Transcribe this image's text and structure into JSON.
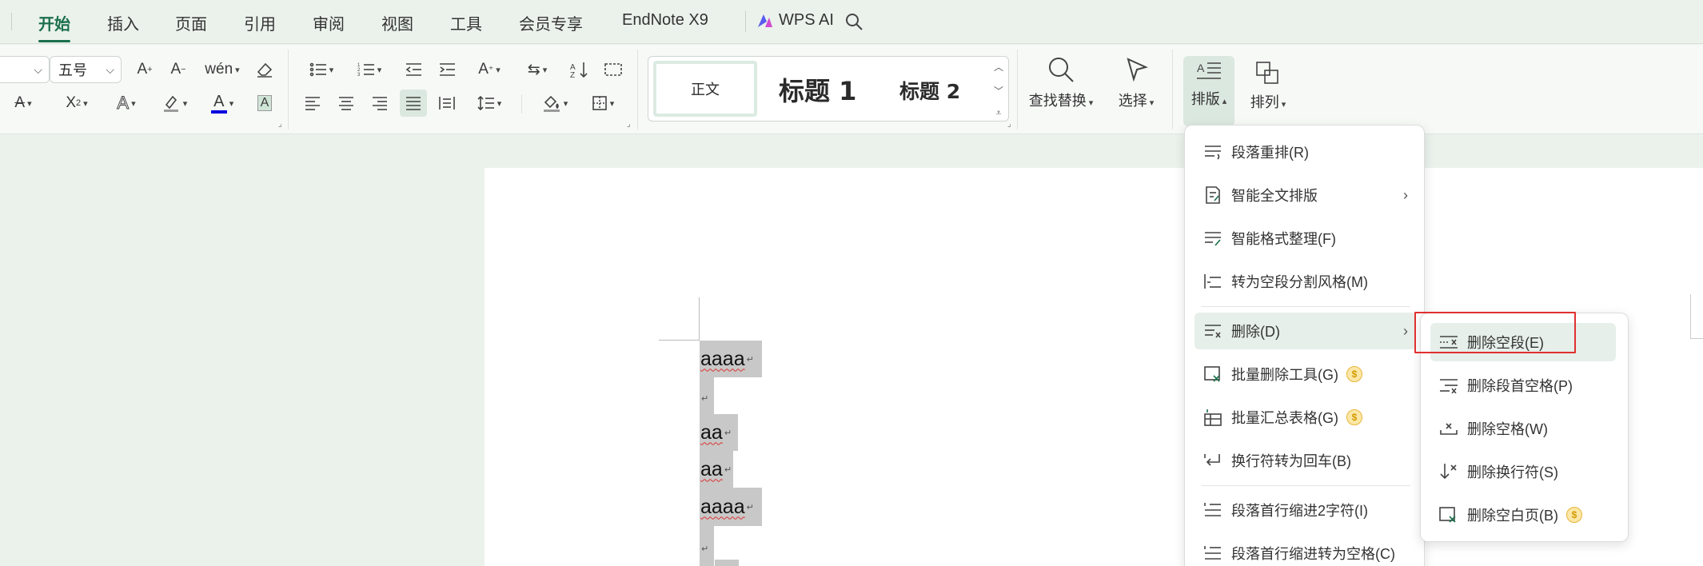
{
  "menubar": {
    "tabs": [
      "开始",
      "插入",
      "页面",
      "引用",
      "审阅",
      "视图",
      "工具",
      "会员专享",
      "EndNote X9"
    ],
    "wps_ai": "WPS AI",
    "search_icon": "search-icon"
  },
  "ribbon": {
    "font_size": "五号",
    "styles": {
      "normal": "正文",
      "h1": "标题 1",
      "h2": "标题 2"
    },
    "find_replace": "查找替换",
    "select": "选择",
    "layout": "排版",
    "arrange": "排列"
  },
  "document": {
    "lines": [
      "aaaa",
      "",
      "aa",
      "aa",
      "aaaa",
      ""
    ]
  },
  "layout_menu": {
    "items": [
      {
        "label": "段落重排(R)",
        "icon": "paragraph-reflow-icon"
      },
      {
        "label": "智能全文排版",
        "icon": "smart-layout-icon",
        "submenu": true
      },
      {
        "label": "智能格式整理(F)",
        "icon": "smart-format-icon"
      },
      {
        "label": "转为空段分割风格(M)",
        "icon": "blank-split-icon"
      },
      {
        "label": "删除(D)",
        "icon": "delete-lines-icon",
        "submenu": true
      },
      {
        "label": "批量删除工具(G)",
        "icon": "batch-delete-icon",
        "vip": true
      },
      {
        "label": "批量汇总表格(G)",
        "icon": "batch-table-icon",
        "vip": true
      },
      {
        "label": "换行符转为回车(B)",
        "icon": "linebreak-to-enter-icon"
      },
      {
        "label": "段落首行缩进2字符(I)",
        "icon": "first-line-indent-icon"
      },
      {
        "label": "段落首行缩进转为空格(C)",
        "icon": "indent-to-space-icon"
      }
    ]
  },
  "delete_submenu": {
    "items": [
      {
        "label": "删除空段(E)",
        "icon": "delete-empty-paragraph-icon"
      },
      {
        "label": "删除段首空格(P)",
        "icon": "delete-leading-space-icon"
      },
      {
        "label": "删除空格(W)",
        "icon": "delete-space-icon"
      },
      {
        "label": "删除换行符(S)",
        "icon": "delete-linebreak-icon"
      },
      {
        "label": "删除空白页(B)",
        "icon": "delete-blank-page-icon",
        "vip": true
      }
    ]
  },
  "colors": {
    "accent": "#1b6f4c",
    "highlight_border": "#e03030",
    "selection": "#c8c8c8"
  }
}
